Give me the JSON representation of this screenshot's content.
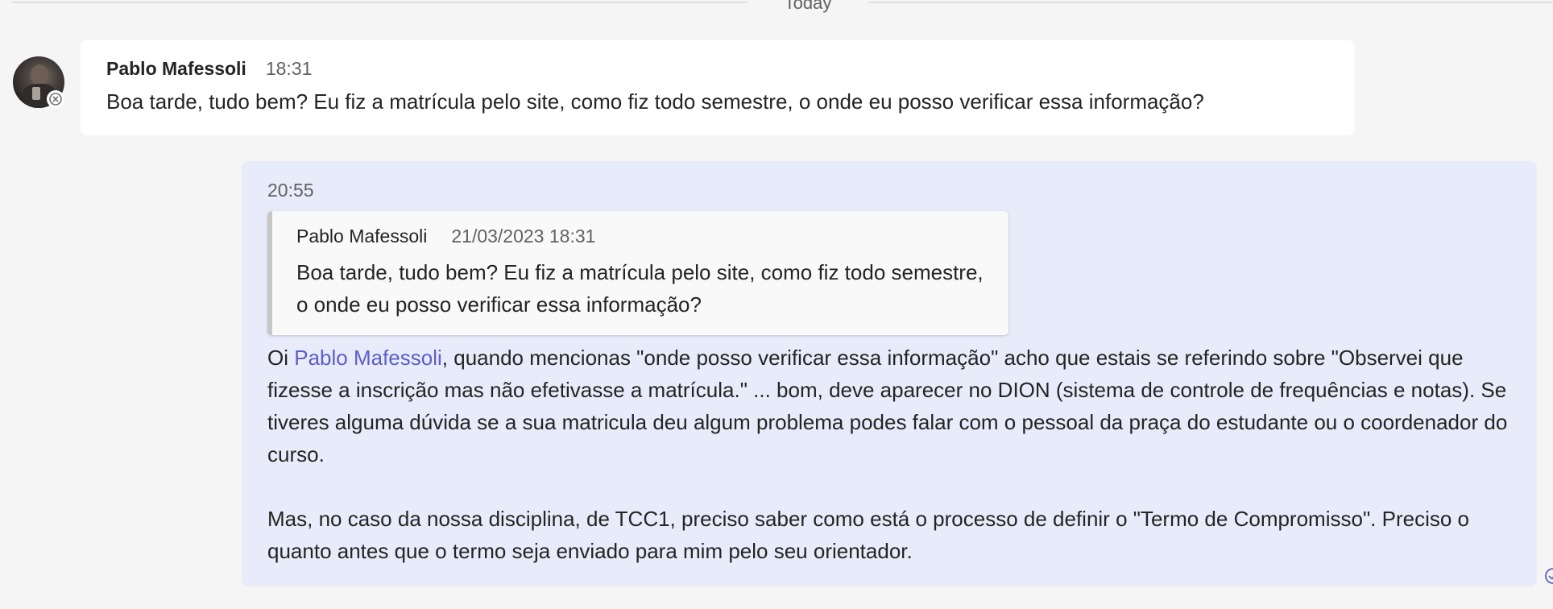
{
  "divider": {
    "label": "Today"
  },
  "incoming": {
    "sender": "Pablo Mafessoli",
    "time": "18:31",
    "text": "Boa tarde, tudo bem? Eu fiz a matrícula pelo site, como fiz todo semestre, o onde eu posso verificar essa informação?"
  },
  "outgoing": {
    "time": "20:55",
    "quote": {
      "sender": "Pablo Mafessoli",
      "timestamp": "21/03/2023 18:31",
      "text": "Boa tarde, tudo bem? Eu fiz a matrícula pelo site, como fiz todo semestre, o onde eu posso verificar essa informação?"
    },
    "greeting": "Oi ",
    "mention": "Pablo Mafessoli",
    "paragraph1_rest": ", quando mencionas \"onde posso verificar essa informação\" acho que estais se referindo sobre \"Observei que fizesse a inscrição mas não efetivasse a matrícula.\" ... bom, deve aparecer no DION (sistema de controle de frequências e notas). Se tiveres alguma dúvida se a sua matricula deu algum problema podes falar com o pessoal da praça do estudante ou o coordenador do curso.",
    "paragraph2": "Mas, no caso da nossa disciplina, de TCC1, preciso saber como está o processo de definir o \"Termo de Compromisso\". Preciso o quanto antes que o termo seja enviado para mim pelo seu orientador."
  },
  "colors": {
    "background": "#f5f5f5",
    "incoming_bubble": "#ffffff",
    "outgoing_bubble": "#e8ebfa",
    "mention": "#5b5fc7"
  },
  "icons": {
    "avatar": "avatar-photo",
    "presence": "offline-x-icon",
    "receipt": "read-receipt-icon"
  }
}
